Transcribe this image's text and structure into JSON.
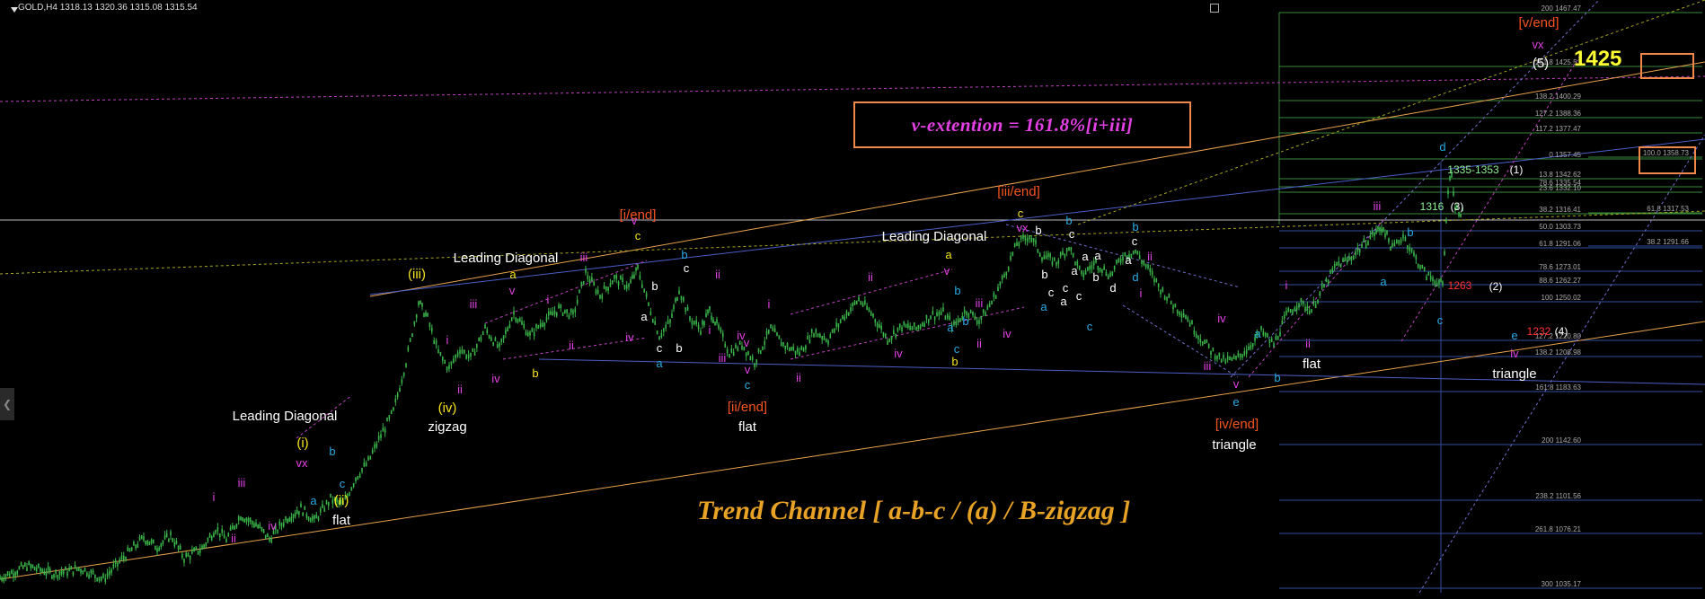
{
  "header": {
    "symbol": "GOLD,H4",
    "ohlc": "1318.13 1320.36 1315.08 1315.54"
  },
  "annotations": {
    "v_extention": "v-extention = 161.8%[i+iii]",
    "trend_channel": "Trend Channel  [ a-b-c / (a) / B-zigzag ]",
    "target_1425": "1425"
  },
  "colors": {
    "background": "#000000",
    "candle": "#39b54a",
    "magenta": "#e540e5",
    "yellow": "#f5e31a",
    "cyan": "#29abe2",
    "orange_red": "#f7541f",
    "white": "#ffffff",
    "orange_line": "#e8a24e",
    "blue_line": "#4a5fc9"
  },
  "labels": [
    {
      "t": "[i/end]",
      "c": "orange_red",
      "x": 710,
      "y": 244
    },
    {
      "t": "c",
      "c": "yellow",
      "x": 710,
      "y": 267
    },
    {
      "t": "[iii/end]",
      "c": "orange_red",
      "x": 1134,
      "y": 218
    },
    {
      "t": "c",
      "c": "yellow",
      "x": 1136,
      "y": 242
    },
    {
      "t": "[ii/end]",
      "c": "orange_red",
      "x": 832,
      "y": 458
    },
    {
      "t": "flat",
      "c": "white",
      "x": 832,
      "y": 480
    },
    {
      "t": "[iv/end]",
      "c": "orange_red",
      "x": 1377,
      "y": 477
    },
    {
      "t": "triangle",
      "c": "white",
      "x": 1374,
      "y": 500
    },
    {
      "t": "[v/end]",
      "c": "orange_red",
      "x": 1713,
      "y": 30
    },
    {
      "t": "vx",
      "c": "magenta",
      "x": 1712,
      "y": 54
    },
    {
      "t": "(5)",
      "c": "white",
      "x": 1715,
      "y": 75
    },
    {
      "t": "(iii)",
      "c": "yellow",
      "x": 464,
      "y": 310
    },
    {
      "t": "(iv)",
      "c": "yellow",
      "x": 498,
      "y": 459
    },
    {
      "t": "zigzag",
      "c": "white",
      "x": 498,
      "y": 480
    },
    {
      "t": "(i)",
      "c": "yellow",
      "x": 337,
      "y": 498
    },
    {
      "t": "vx",
      "c": "magenta",
      "x": 336,
      "y": 520
    },
    {
      "t": "(ii)",
      "c": "yellow",
      "x": 380,
      "y": 562
    },
    {
      "t": "flat",
      "c": "white",
      "x": 380,
      "y": 584
    },
    {
      "t": "Leading Diagonal",
      "c": "white",
      "x": 317,
      "y": 468
    },
    {
      "t": "Leading Diagonal",
      "c": "white",
      "x": 563,
      "y": 292
    },
    {
      "t": "Leading Diagonal",
      "c": "white",
      "x": 1040,
      "y": 268
    },
    {
      "t": "triangle",
      "c": "white",
      "x": 1686,
      "y": 421
    },
    {
      "t": "flat",
      "c": "white",
      "x": 1460,
      "y": 410
    },
    {
      "t": "d",
      "c": "cyan",
      "x": 1606,
      "y": 168
    },
    {
      "t": "iii",
      "c": "magenta",
      "x": 1533,
      "y": 234
    },
    {
      "t": "b",
      "c": "cyan",
      "x": 1570,
      "y": 263
    },
    {
      "t": "a",
      "c": "cyan",
      "x": 1540,
      "y": 318
    },
    {
      "t": "c",
      "c": "cyan",
      "x": 1603,
      "y": 361
    },
    {
      "t": "e",
      "c": "cyan",
      "x": 1686,
      "y": 378
    },
    {
      "t": "iv",
      "c": "magenta",
      "x": 1686,
      "y": 398
    },
    {
      "t": "i",
      "c": "magenta",
      "x": 1432,
      "y": 322
    },
    {
      "t": "ii",
      "c": "magenta",
      "x": 1456,
      "y": 387
    },
    {
      "t": "a",
      "c": "cyan",
      "x": 1400,
      "y": 376
    },
    {
      "t": "b",
      "c": "cyan",
      "x": 1422,
      "y": 425
    },
    {
      "t": "iv",
      "c": "magenta",
      "x": 1360,
      "y": 359
    },
    {
      "t": "iii",
      "c": "magenta",
      "x": 1344,
      "y": 412
    },
    {
      "t": "v",
      "c": "magenta",
      "x": 1376,
      "y": 432
    },
    {
      "t": "e",
      "c": "cyan",
      "x": 1376,
      "y": 452
    },
    {
      "t": "b",
      "c": "cyan",
      "x": 1190,
      "y": 250
    },
    {
      "t": "b",
      "c": "cyan",
      "x": 1264,
      "y": 257
    },
    {
      "t": "ii",
      "c": "magenta",
      "x": 1280,
      "y": 290
    },
    {
      "t": "i",
      "c": "magenta",
      "x": 1270,
      "y": 331
    },
    {
      "t": "a",
      "c": "cyan",
      "x": 1162,
      "y": 346
    },
    {
      "t": "c",
      "c": "cyan",
      "x": 1213,
      "y": 368
    },
    {
      "t": "vx",
      "c": "magenta",
      "x": 1138,
      "y": 258
    },
    {
      "t": "ii",
      "c": "magenta",
      "x": 969,
      "y": 313
    },
    {
      "t": "iv",
      "c": "magenta",
      "x": 1000,
      "y": 398
    },
    {
      "t": "v",
      "c": "magenta",
      "x": 1054,
      "y": 306
    },
    {
      "t": "b",
      "c": "cyan",
      "x": 1066,
      "y": 328
    },
    {
      "t": "a",
      "c": "cyan",
      "x": 1058,
      "y": 369
    },
    {
      "t": "a",
      "c": "yellow",
      "x": 1056,
      "y": 288
    },
    {
      "t": "b",
      "c": "cyan",
      "x": 1075,
      "y": 362
    },
    {
      "t": "c",
      "c": "cyan",
      "x": 1065,
      "y": 393
    },
    {
      "t": "b",
      "c": "yellow",
      "x": 1063,
      "y": 407
    },
    {
      "t": "iii",
      "c": "magenta",
      "x": 1090,
      "y": 342
    },
    {
      "t": "ii",
      "c": "magenta",
      "x": 1090,
      "y": 387
    },
    {
      "t": "iv",
      "c": "magenta",
      "x": 1121,
      "y": 376
    },
    {
      "t": "i",
      "c": "magenta",
      "x": 856,
      "y": 343
    },
    {
      "t": "iii",
      "c": "magenta",
      "x": 804,
      "y": 403
    },
    {
      "t": "iv",
      "c": "magenta",
      "x": 825,
      "y": 378
    },
    {
      "t": "v",
      "c": "magenta",
      "x": 831,
      "y": 386
    },
    {
      "t": "v",
      "c": "magenta",
      "x": 832,
      "y": 416
    },
    {
      "t": "c",
      "c": "cyan",
      "x": 832,
      "y": 433
    },
    {
      "t": "ii",
      "c": "magenta",
      "x": 889,
      "y": 425
    },
    {
      "t": "ii",
      "c": "magenta",
      "x": 799,
      "y": 310
    },
    {
      "t": "i",
      "c": "magenta",
      "x": 790,
      "y": 372
    },
    {
      "t": "b",
      "c": "cyan",
      "x": 762,
      "y": 288
    },
    {
      "t": "c",
      "c": "white",
      "x": 764,
      "y": 303
    },
    {
      "t": "a",
      "c": "cyan",
      "x": 734,
      "y": 409
    },
    {
      "t": "b",
      "c": "white",
      "x": 756,
      "y": 392
    },
    {
      "t": "c",
      "c": "white",
      "x": 734,
      "y": 392
    },
    {
      "t": "a",
      "c": "white",
      "x": 717,
      "y": 357
    },
    {
      "t": "b",
      "c": "white",
      "x": 729,
      "y": 323
    },
    {
      "t": "v",
      "c": "magenta",
      "x": 706,
      "y": 250
    },
    {
      "t": "iii",
      "c": "magenta",
      "x": 650,
      "y": 291
    },
    {
      "t": "iv",
      "c": "magenta",
      "x": 701,
      "y": 380
    },
    {
      "t": "i",
      "c": "magenta",
      "x": 610,
      "y": 338
    },
    {
      "t": "ii",
      "c": "magenta",
      "x": 636,
      "y": 389
    },
    {
      "t": "a",
      "c": "yellow",
      "x": 571,
      "y": 310
    },
    {
      "t": "v",
      "c": "magenta",
      "x": 570,
      "y": 328
    },
    {
      "t": "b",
      "c": "yellow",
      "x": 596,
      "y": 420
    },
    {
      "t": "iii",
      "c": "magenta",
      "x": 527,
      "y": 343
    },
    {
      "t": "iv",
      "c": "magenta",
      "x": 552,
      "y": 426
    },
    {
      "t": "i",
      "c": "magenta",
      "x": 498,
      "y": 383
    },
    {
      "t": "ii",
      "c": "magenta",
      "x": 512,
      "y": 438
    },
    {
      "t": "b",
      "c": "cyan",
      "x": 370,
      "y": 507
    },
    {
      "t": "a",
      "c": "cyan",
      "x": 349,
      "y": 562
    },
    {
      "t": "c",
      "c": "cyan",
      "x": 381,
      "y": 543
    },
    {
      "t": "iii",
      "c": "magenta",
      "x": 269,
      "y": 542
    },
    {
      "t": "iv",
      "c": "magenta",
      "x": 303,
      "y": 590
    },
    {
      "t": "i",
      "c": "magenta",
      "x": 238,
      "y": 558
    },
    {
      "t": "ii",
      "c": "magenta",
      "x": 260,
      "y": 604
    },
    {
      "t": "d",
      "c": "cyan",
      "x": 1264,
      "y": 313
    },
    {
      "t": "b",
      "c": "white",
      "x": 1156,
      "y": 261
    },
    {
      "t": "c",
      "c": "white",
      "x": 1193,
      "y": 265
    },
    {
      "t": "a",
      "c": "white",
      "x": 1222,
      "y": 289
    },
    {
      "t": "c",
      "c": "white",
      "x": 1263,
      "y": 273
    },
    {
      "t": "a",
      "c": "white",
      "x": 1196,
      "y": 306
    },
    {
      "t": "b",
      "c": "white",
      "x": 1220,
      "y": 313
    },
    {
      "t": "c",
      "c": "white",
      "x": 1186,
      "y": 325
    },
    {
      "t": "b",
      "c": "white",
      "x": 1163,
      "y": 310
    },
    {
      "t": "c",
      "c": "white",
      "x": 1170,
      "y": 330
    },
    {
      "t": "a",
      "c": "white",
      "x": 1184,
      "y": 340
    },
    {
      "t": "c",
      "c": "white",
      "x": 1201,
      "y": 334
    },
    {
      "t": "d",
      "c": "white",
      "x": 1239,
      "y": 325
    },
    {
      "t": "a",
      "c": "white",
      "x": 1256,
      "y": 294
    },
    {
      "t": "a",
      "c": "white",
      "x": 1208,
      "y": 290
    }
  ],
  "price_markers": [
    {
      "t": "1335-1353",
      "c": "#90ee90",
      "x": 1640,
      "y": 193
    },
    {
      "t": "(1)",
      "c": "#ffffff",
      "x": 1688,
      "y": 193
    },
    {
      "t": "1316",
      "c": "#90ee90",
      "x": 1594,
      "y": 234
    },
    {
      "t": "(3)",
      "c": "#ffffff",
      "x": 1622,
      "y": 234
    },
    {
      "t": "1263",
      "c": "#ff3333",
      "x": 1625,
      "y": 322
    },
    {
      "t": "(2)",
      "c": "#ffffff",
      "x": 1665,
      "y": 323
    },
    {
      "t": "1232",
      "c": "#ff3333",
      "x": 1713,
      "y": 373
    },
    {
      "t": "(4)",
      "c": "#ffffff",
      "x": 1738,
      "y": 373
    }
  ],
  "fib_levels": [
    {
      "t": "200 1467.47",
      "y": 14
    },
    {
      "t": "161.8 1425.51",
      "y": 74
    },
    {
      "t": "138.2 1400.29",
      "y": 112
    },
    {
      "t": "127.2 1388.36",
      "y": 131
    },
    {
      "t": "117.2 1377.47",
      "y": 148
    },
    {
      "t": "0 1357.45",
      "y": 177
    },
    {
      "t": "13.8 1342.62",
      "y": 199
    },
    {
      "t": "23.6 1332.10",
      "y": 214
    },
    {
      "t": "78.6 1335.54",
      "y": 208
    },
    {
      "t": "38.2 1316.41",
      "y": 238
    },
    {
      "t": "50.0 1303.73",
      "y": 257
    },
    {
      "t": "61.8 1291.06",
      "y": 276
    },
    {
      "t": "38.2 1291.66",
      "y": 274
    },
    {
      "t": "78.6 1273.01",
      "y": 302
    },
    {
      "t": "88.6 1262.27",
      "y": 317
    },
    {
      "t": "100 1250.02",
      "y": 336
    },
    {
      "t": "127.2 1220.80",
      "y": 379
    },
    {
      "t": "138.2 1208.98",
      "y": 397
    },
    {
      "t": "161.8 1183.63",
      "y": 436
    },
    {
      "t": "200 1142.60",
      "y": 495
    },
    {
      "t": "238.2 1101.56",
      "y": 557
    },
    {
      "t": "261.8 1076.21",
      "y": 594
    },
    {
      "t": "300 1035.17",
      "y": 655
    },
    {
      "t": "100.0 1358.73",
      "y": 175
    },
    {
      "t": "61.8 1317.53",
      "y": 237
    }
  ],
  "chart_data": {
    "type": "candlestick",
    "title": "GOLD,H4",
    "ylabel": "",
    "xlabel": "",
    "ylim": [
      1035,
      1467
    ],
    "note_series": "price path approximated from the visual waveform",
    "price_path": [
      [
        0,
        1043
      ],
      [
        30,
        1052
      ],
      [
        60,
        1046
      ],
      [
        90,
        1050
      ],
      [
        115,
        1042
      ],
      [
        140,
        1060
      ],
      [
        160,
        1073
      ],
      [
        175,
        1066
      ],
      [
        190,
        1075
      ],
      [
        205,
        1058
      ],
      [
        225,
        1065
      ],
      [
        240,
        1080
      ],
      [
        252,
        1072
      ],
      [
        268,
        1090
      ],
      [
        285,
        1083
      ],
      [
        300,
        1072
      ],
      [
        318,
        1087
      ],
      [
        335,
        1095
      ],
      [
        350,
        1086
      ],
      [
        368,
        1102
      ],
      [
        382,
        1098
      ],
      [
        396,
        1118
      ],
      [
        410,
        1130
      ],
      [
        424,
        1150
      ],
      [
        438,
        1168
      ],
      [
        452,
        1205
      ],
      [
        466,
        1250
      ],
      [
        476,
        1238
      ],
      [
        488,
        1212
      ],
      [
        500,
        1200
      ],
      [
        512,
        1215
      ],
      [
        524,
        1208
      ],
      [
        540,
        1230
      ],
      [
        556,
        1215
      ],
      [
        572,
        1242
      ],
      [
        590,
        1225
      ],
      [
        604,
        1235
      ],
      [
        622,
        1245
      ],
      [
        638,
        1240
      ],
      [
        652,
        1272
      ],
      [
        668,
        1255
      ],
      [
        684,
        1268
      ],
      [
        700,
        1262
      ],
      [
        710,
        1275
      ],
      [
        722,
        1248
      ],
      [
        734,
        1225
      ],
      [
        746,
        1235
      ],
      [
        756,
        1260
      ],
      [
        768,
        1238
      ],
      [
        780,
        1230
      ],
      [
        790,
        1244
      ],
      [
        800,
        1230
      ],
      [
        812,
        1212
      ],
      [
        826,
        1218
      ],
      [
        840,
        1205
      ],
      [
        858,
        1230
      ],
      [
        872,
        1218
      ],
      [
        890,
        1212
      ],
      [
        906,
        1228
      ],
      [
        922,
        1222
      ],
      [
        938,
        1238
      ],
      [
        956,
        1252
      ],
      [
        972,
        1240
      ],
      [
        988,
        1222
      ],
      [
        1004,
        1232
      ],
      [
        1020,
        1230
      ],
      [
        1036,
        1240
      ],
      [
        1050,
        1242
      ],
      [
        1062,
        1232
      ],
      [
        1076,
        1244
      ],
      [
        1090,
        1236
      ],
      [
        1104,
        1250
      ],
      [
        1118,
        1270
      ],
      [
        1132,
        1294
      ],
      [
        1146,
        1300
      ],
      [
        1160,
        1285
      ],
      [
        1176,
        1280
      ],
      [
        1190,
        1292
      ],
      [
        1204,
        1270
      ],
      [
        1220,
        1280
      ],
      [
        1236,
        1270
      ],
      [
        1250,
        1285
      ],
      [
        1264,
        1288
      ],
      [
        1278,
        1275
      ],
      [
        1292,
        1260
      ],
      [
        1306,
        1248
      ],
      [
        1320,
        1240
      ],
      [
        1334,
        1225
      ],
      [
        1348,
        1214
      ],
      [
        1362,
        1206
      ],
      [
        1376,
        1207
      ],
      [
        1390,
        1216
      ],
      [
        1404,
        1228
      ],
      [
        1418,
        1218
      ],
      [
        1432,
        1240
      ],
      [
        1446,
        1250
      ],
      [
        1460,
        1244
      ],
      [
        1474,
        1262
      ],
      [
        1488,
        1278
      ],
      [
        1502,
        1282
      ],
      [
        1516,
        1292
      ],
      [
        1530,
        1302
      ],
      [
        1540,
        1306
      ],
      [
        1550,
        1290
      ],
      [
        1562,
        1300
      ],
      [
        1574,
        1285
      ],
      [
        1588,
        1270
      ],
      [
        1602,
        1265
      ],
      [
        1606,
        1262
      ],
      [
        1612,
        1335
      ],
      [
        1616,
        1348
      ],
      [
        1620,
        1320
      ],
      [
        1626,
        1318
      ],
      [
        1630,
        1316
      ]
    ]
  }
}
